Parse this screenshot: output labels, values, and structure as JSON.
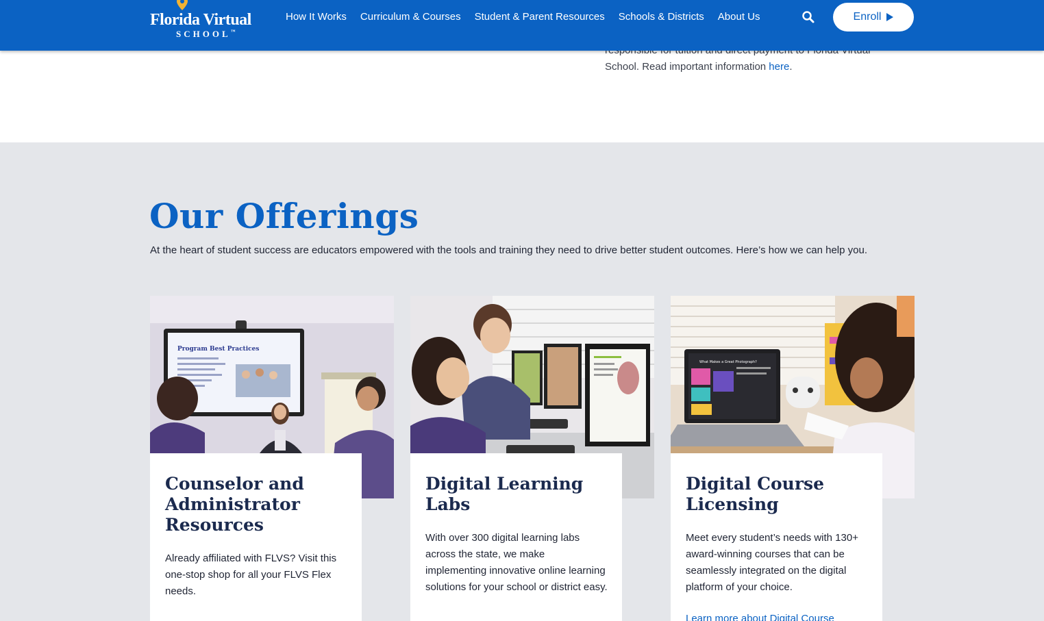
{
  "header": {
    "logo_line1": "Florida Virtual",
    "logo_line2": "SCHOOL",
    "logo_tm": "™",
    "nav": [
      "How It Works",
      "Curriculum & Courses",
      "Student & Parent Resources",
      "Schools & Districts",
      "About Us"
    ],
    "search_icon": "search-icon",
    "enroll_label": "Enroll"
  },
  "notice": {
    "text_partial": "responsible for tuition and direct payment to Florida Virtual School. Read important information",
    "link": "here",
    "trailing": "."
  },
  "offerings": {
    "title": "Our Offerings",
    "intro": "At the heart of student success are educators empowered with the tools and training they need to drive better student outcomes. Here’s how we can help you.",
    "cards": [
      {
        "title": "Counselor and Administrator Resources",
        "text": "Already affiliated with FLVS? Visit this one-stop shop for all your FLVS Flex needs.",
        "image_icon": "classroom-presentation-photo",
        "screen_text": "Program Best Practices"
      },
      {
        "title": "Digital Learning Labs",
        "text": "With over 300 digital learning labs across the state, we make implementing innovative online learning solutions for your school or district easy.",
        "image_icon": "computer-lab-photo"
      },
      {
        "title": "Digital Course Licensing",
        "text": "Meet every student’s needs with 130+ award-winning courses that can be seamlessly integrated on the digital platform of your choice.",
        "link": "Learn more about Digital Course",
        "image_icon": "student-laptop-photo",
        "screen_text": "What Makes a Great Photograph?"
      }
    ]
  },
  "colors": {
    "brand_blue": "#0b62c3",
    "section_gray": "#e4e6ea",
    "heading_navy": "#1b2a4e",
    "logo_pin": "#f2b233"
  }
}
